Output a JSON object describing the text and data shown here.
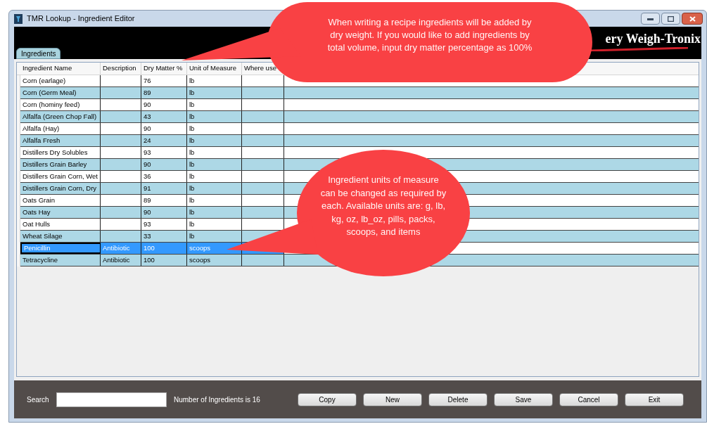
{
  "window": {
    "title": "TMR Lookup - Ingredient Editor"
  },
  "banner": {
    "logo_text": "ery Weigh-Tronix"
  },
  "tabs": [
    {
      "label": "Ingredients",
      "selected": true
    }
  ],
  "table": {
    "columns": [
      "Ingredient Name",
      "Description",
      "Dry Matter %",
      "Unit of Measure",
      "Where use"
    ],
    "rows": [
      {
        "name": "Corn (earlage)",
        "description": "",
        "dry_matter": "76",
        "unit": "lb",
        "selected": false
      },
      {
        "name": "Corn (Germ Meal)",
        "description": "",
        "dry_matter": "89",
        "unit": "lb",
        "selected": false
      },
      {
        "name": "Corn (hominy feed)",
        "description": "",
        "dry_matter": "90",
        "unit": "lb",
        "selected": false
      },
      {
        "name": "Alfalfa (Green Chop Fall)",
        "description": "",
        "dry_matter": "43",
        "unit": "lb",
        "selected": false
      },
      {
        "name": "Alfalfa (Hay)",
        "description": "",
        "dry_matter": "90",
        "unit": "lb",
        "selected": false
      },
      {
        "name": "Alfalfa Fresh",
        "description": "",
        "dry_matter": "24",
        "unit": "lb",
        "selected": false
      },
      {
        "name": "Distillers Dry Solubles",
        "description": "",
        "dry_matter": "93",
        "unit": "lb",
        "selected": false
      },
      {
        "name": "Distillers Grain Barley",
        "description": "",
        "dry_matter": "90",
        "unit": "lb",
        "selected": false
      },
      {
        "name": "Distillers Grain Corn, Wet",
        "description": "",
        "dry_matter": "36",
        "unit": "lb",
        "selected": false
      },
      {
        "name": "Distillers Grain Corn, Dry",
        "description": "",
        "dry_matter": "91",
        "unit": "lb",
        "selected": false
      },
      {
        "name": "Oats Grain",
        "description": "",
        "dry_matter": "89",
        "unit": "lb",
        "selected": false
      },
      {
        "name": "Oats Hay",
        "description": "",
        "dry_matter": "90",
        "unit": "lb",
        "selected": false
      },
      {
        "name": "Oat Hulls",
        "description": "",
        "dry_matter": "93",
        "unit": "lb",
        "selected": false
      },
      {
        "name": "Wheat Silage",
        "description": "",
        "dry_matter": "33",
        "unit": "lb",
        "selected": false
      },
      {
        "name": "Penicillin",
        "description": "Antibiotic",
        "dry_matter": "100",
        "unit": "scoops",
        "selected": true
      },
      {
        "name": "Tetracycline",
        "description": "Antibiotic",
        "dry_matter": "100",
        "unit": "scoops",
        "selected": false
      }
    ]
  },
  "footer": {
    "search_label": "Search",
    "count": "Number of Ingredients is 16",
    "buttons": [
      "Copy",
      "New",
      "Delete",
      "Save",
      "Cancel",
      "Exit"
    ]
  },
  "callouts": [
    {
      "text": "When writing a recipe ingredients will be added by dry weight. If you would like to add ingredients by total volume, input dry matter percentage as 100%"
    },
    {
      "text": "Ingredient units of measure can be changed as required by each. Available units are: g, lb, kg, oz, lb_oz, pills, packs, scoops, and items"
    }
  ]
}
